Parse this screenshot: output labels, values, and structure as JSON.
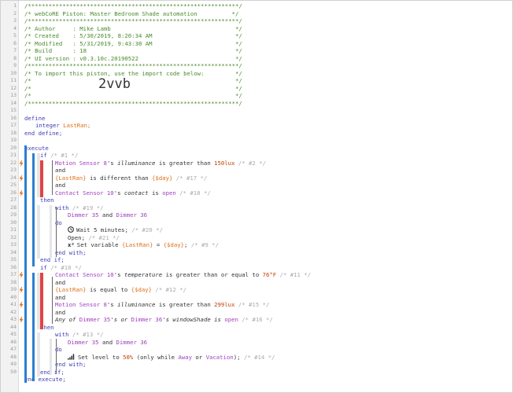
{
  "header_comment": {
    "border": "/*************************************************************/",
    "title": "/* webCoRE Piston: Master Bedroom Shade automation          */",
    "author": "/* Author     : Mike Lamb                                    */",
    "created": "/* Created    : 5/30/2019, 8:20:34 AM                        */",
    "modified": "/* Modified   : 5/31/2019, 9:43:30 AM                        */",
    "build": "/* Build      : 18                                           */",
    "ui_version": "/* UI version : v0.3.10c.20190522                            */",
    "import_line": "/* To import this piston, use the import code below:         */",
    "blank": "/*                                                           */",
    "import_code": "2vvb"
  },
  "code": {
    "define": "define",
    "integer_kw": "integer",
    "lastran": "LastRan;",
    "end_define": "end define;",
    "execute": "execute",
    "if": "if",
    "c1": "/* #1 */",
    "motion1": "Motion Sensor 8",
    "illum_s": "'s ",
    "illuminance": "illuminance",
    "gt": " is greater than ",
    "lux150": "150lux",
    "c2": " /* #2 */",
    "and": "and",
    "lastran_var": "{LastRan}",
    "diff": " is different than ",
    "day_var": "{$day}",
    "c17": " /* #17 */",
    "contact": "Contact Sensor 10",
    "contact_s": "'s ",
    "contact_attr": "contact",
    "is_open": " is ",
    "open": "open",
    "c18": " /* #18 */",
    "then": "then",
    "with": "with",
    "c19": " /* #19 */",
    "dimmer35": "Dimmer 35",
    "and_w": " and ",
    "dimmer36": "Dimmer 36",
    "do": "do",
    "wait": "Wait ",
    "wait_val": "5 minutes",
    "semi": ";",
    "c20": " /* #20 */",
    "open_cmd": "Open;",
    "c21": " /* #21 */",
    "set_var": "Set variable ",
    "eq": " = ",
    "set_end": ";",
    "c9": " /* #9 */",
    "end_with": "end with;",
    "end_if": "end if;",
    "c10": "/* #10 */",
    "temperature": "temperature",
    "gte": " is greater than or equal to ",
    "temp76": "76°F",
    "c11": " /* #11 */",
    "equal": " is equal to ",
    "c12": " /* #12 */",
    "lux299": "299lux",
    "c15": " /* #15 */",
    "any_of": "Any of ",
    "dimmer35s": "Dimmer 35",
    "s_or": "'s or ",
    "dimmer36s": "Dimmer 36",
    "ws_s": "'s ",
    "window_shade": "windowShade",
    "is": " is ",
    "open2": "open",
    "c16": " /* #16 */",
    "c13": " /* #13 */",
    "set_level": "Set level to ",
    "level": "50%",
    "only_while": " (only while ",
    "away": "Away",
    "or": " or ",
    "vacation": "Vacation",
    "paren_end": ");",
    "c14": " /* #14 */",
    "end_execute": "end execute;"
  },
  "line_numbers": [
    "1",
    "2",
    "3",
    "4",
    "5",
    "6",
    "7",
    "8",
    "9",
    "10",
    "11",
    "12",
    "13",
    "14",
    "15",
    "16",
    "17",
    "18",
    "19",
    "20",
    "21",
    "22",
    "23",
    "24",
    "25",
    "26",
    "27",
    "28",
    "29",
    "30",
    "31",
    "32",
    "33",
    "34",
    "35",
    "36",
    "37",
    "38",
    "39",
    "40",
    "41",
    "42",
    "43",
    "44",
    "45",
    "46",
    "47",
    "48",
    "49",
    "50"
  ],
  "colors": {
    "comment": "#4a8a2a",
    "keyword": "#3c3cb4",
    "device": "#a040c0",
    "variable": "#e07018",
    "gutter_bar": "#2a7fd0",
    "trigger_bar": "#e04545"
  },
  "icons": {
    "wait": "clock-icon",
    "set_variable": "variable-icon",
    "set_level": "signal-bars-icon",
    "trigger": "lightning-trigger-icon"
  }
}
